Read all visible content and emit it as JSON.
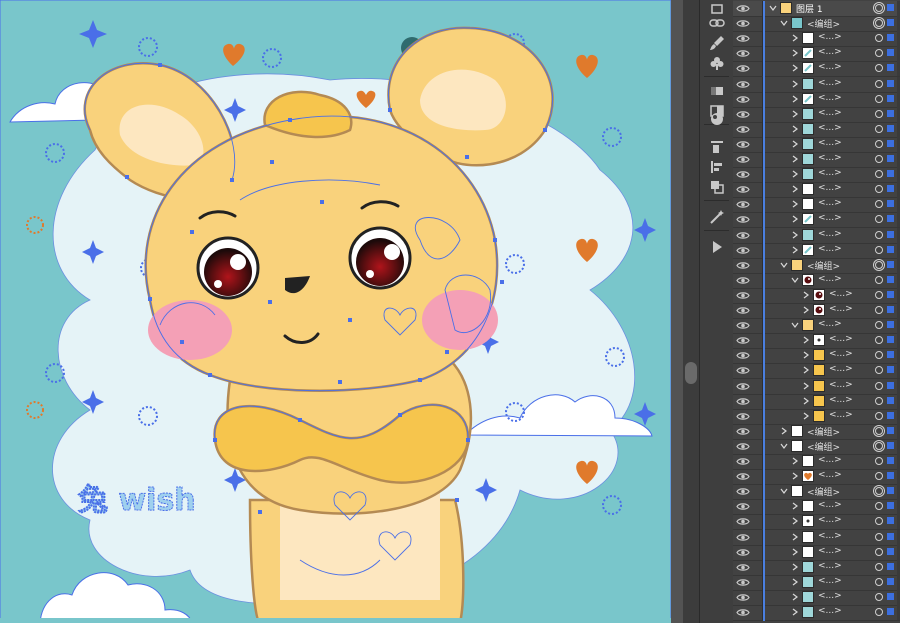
{
  "app": "Adobe Illustrator",
  "artwork": {
    "background_color": "#79c6cb",
    "blob_color": "#e5f3f7",
    "bunny_color": "#f9d27c",
    "bunny_outline": "#b48a53",
    "blush_color": "#f4a0b6",
    "heart_color": "#e07a2c",
    "selection_color": "#4a6fe8",
    "text_art": "兔 wish"
  },
  "tools": [
    {
      "icon": "libraries-icon"
    },
    {
      "icon": "link-icon"
    },
    {
      "icon": "brush-icon"
    },
    {
      "icon": "club-symbol-icon"
    },
    {
      "icon": "gradient-icon"
    },
    {
      "icon": "transparency-icon"
    },
    {
      "icon": "appearance-icon"
    },
    {
      "icon": "align-icon"
    },
    {
      "icon": "pathfinder-icon"
    },
    {
      "icon": "magic-wand-icon"
    },
    {
      "icon": "actions-play-icon"
    }
  ],
  "layers": {
    "top_layer": "图层 1",
    "group_label": "<编组>",
    "item_label": "<...>",
    "rows": [
      {
        "type": "layer",
        "label": "图层 1",
        "indent": 0,
        "expanded": true,
        "thumb": "bunny",
        "selected": true
      },
      {
        "type": "group",
        "label": "<编组>",
        "indent": 1,
        "expanded": true,
        "thumb": "scene"
      },
      {
        "type": "item",
        "label": "<...>",
        "indent": 2,
        "thumb": "white"
      },
      {
        "type": "item",
        "label": "<...>",
        "indent": 2,
        "thumb": "line"
      },
      {
        "type": "item",
        "label": "<...>",
        "indent": 2,
        "thumb": "line"
      },
      {
        "type": "item",
        "label": "<...>",
        "indent": 2,
        "thumb": "teal"
      },
      {
        "type": "item",
        "label": "<...>",
        "indent": 2,
        "thumb": "line"
      },
      {
        "type": "item",
        "label": "<...>",
        "indent": 2,
        "thumb": "teal"
      },
      {
        "type": "item",
        "label": "<...>",
        "indent": 2,
        "thumb": "teal"
      },
      {
        "type": "item",
        "label": "<...>",
        "indent": 2,
        "thumb": "teal"
      },
      {
        "type": "item",
        "label": "<...>",
        "indent": 2,
        "thumb": "teal"
      },
      {
        "type": "item",
        "label": "<...>",
        "indent": 2,
        "thumb": "teal"
      },
      {
        "type": "item",
        "label": "<...>",
        "indent": 2,
        "thumb": "white"
      },
      {
        "type": "item",
        "label": "<...>",
        "indent": 2,
        "thumb": "white"
      },
      {
        "type": "item",
        "label": "<...>",
        "indent": 2,
        "thumb": "line"
      },
      {
        "type": "item",
        "label": "<...>",
        "indent": 2,
        "thumb": "teal"
      },
      {
        "type": "item",
        "label": "<...>",
        "indent": 2,
        "thumb": "line"
      },
      {
        "type": "group",
        "label": "<编组>",
        "indent": 1,
        "expanded": true,
        "thumb": "bunny"
      },
      {
        "type": "item",
        "label": "<...>",
        "indent": 2,
        "expanded": true,
        "thumb": "eyes"
      },
      {
        "type": "item",
        "label": "<...>",
        "indent": 3,
        "thumb": "eye"
      },
      {
        "type": "item",
        "label": "<...>",
        "indent": 3,
        "thumb": "eye"
      },
      {
        "type": "item",
        "label": "<...>",
        "indent": 2,
        "expanded": true,
        "thumb": "bunny"
      },
      {
        "type": "item",
        "label": "<...>",
        "indent": 3,
        "thumb": "dot"
      },
      {
        "type": "item",
        "label": "<...>",
        "indent": 3,
        "thumb": "yellow"
      },
      {
        "type": "item",
        "label": "<...>",
        "indent": 3,
        "thumb": "yellow"
      },
      {
        "type": "item",
        "label": "<...>",
        "indent": 3,
        "thumb": "yellow"
      },
      {
        "type": "item",
        "label": "<...>",
        "indent": 3,
        "thumb": "yellow"
      },
      {
        "type": "item",
        "label": "<...>",
        "indent": 3,
        "thumb": "yellow"
      },
      {
        "type": "group",
        "label": "<编组>",
        "indent": 1,
        "thumb": "white"
      },
      {
        "type": "group",
        "label": "<编组>",
        "indent": 1,
        "expanded": true,
        "thumb": "white"
      },
      {
        "type": "item",
        "label": "<...>",
        "indent": 2,
        "thumb": "white"
      },
      {
        "type": "item",
        "label": "<...>",
        "indent": 2,
        "thumb": "heart"
      },
      {
        "type": "group",
        "label": "<编组>",
        "indent": 1,
        "expanded": true,
        "thumb": "white"
      },
      {
        "type": "item",
        "label": "<...>",
        "indent": 2,
        "thumb": "white"
      },
      {
        "type": "item",
        "label": "<...>",
        "indent": 2,
        "thumb": "dot"
      },
      {
        "type": "item",
        "label": "<...>",
        "indent": 2,
        "thumb": "white"
      },
      {
        "type": "item",
        "label": "<...>",
        "indent": 2,
        "thumb": "white"
      },
      {
        "type": "item",
        "label": "<...>",
        "indent": 2,
        "thumb": "teal"
      },
      {
        "type": "item",
        "label": "<...>",
        "indent": 2,
        "thumb": "teal"
      },
      {
        "type": "item",
        "label": "<...>",
        "indent": 2,
        "thumb": "teal"
      },
      {
        "type": "item",
        "label": "<...>",
        "indent": 2,
        "thumb": "teal"
      }
    ]
  }
}
